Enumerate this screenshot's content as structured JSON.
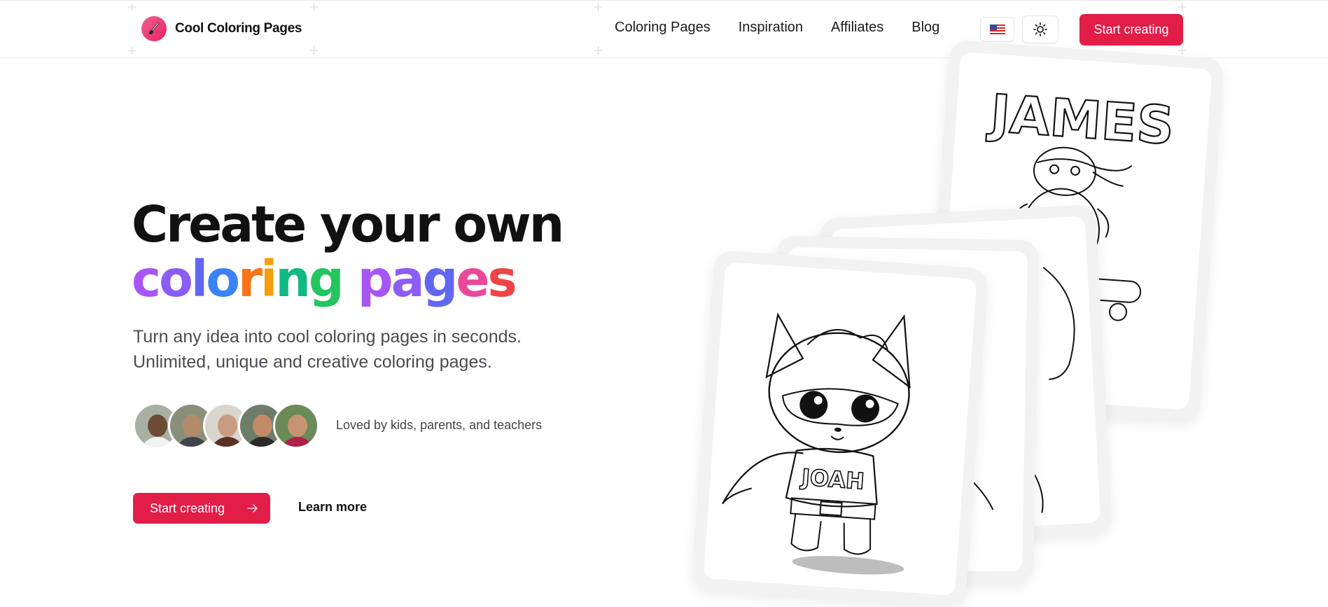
{
  "brand": {
    "name": "Cool Coloring Pages",
    "logo_icon": "paintbrush-icon",
    "accent": "#e11d48"
  },
  "nav": {
    "items": [
      {
        "label": "Coloring Pages"
      },
      {
        "label": "Inspiration"
      },
      {
        "label": "Affiliates"
      },
      {
        "label": "Blog"
      }
    ],
    "language_icon": "us-flag-icon",
    "theme_icon": "sun-icon",
    "cta_label": "Start creating"
  },
  "hero": {
    "title_line1": "Create your own",
    "title_word1_letters": [
      {
        "ch": "c",
        "color": "#a855f7"
      },
      {
        "ch": "o",
        "color": "#8b5cf6"
      },
      {
        "ch": "l",
        "color": "#6366f1"
      },
      {
        "ch": "o",
        "color": "#3b82f6"
      },
      {
        "ch": "r",
        "color": "#f97316"
      },
      {
        "ch": "i",
        "color": "#f59e0b"
      },
      {
        "ch": "n",
        "color": "#10b981"
      },
      {
        "ch": "g",
        "color": "#22c55e"
      }
    ],
    "title_word2_letters": [
      {
        "ch": "p",
        "color": "#a855f7"
      },
      {
        "ch": "a",
        "color": "#8b5cf6"
      },
      {
        "ch": "g",
        "color": "#6366f1"
      },
      {
        "ch": "e",
        "color": "#ec4899"
      },
      {
        "ch": "s",
        "color": "#ef4444"
      }
    ],
    "subtitle_line1": "Turn any idea into cool coloring pages in seconds.",
    "subtitle_line2": "Unlimited, unique and creative coloring pages.",
    "social_proof": "Loved by kids, parents, and teachers",
    "primary_cta": "Start creating",
    "primary_cta_icon": "arrow-right-icon",
    "secondary_cta": "Learn more"
  },
  "cards": {
    "back_card_name": "JAMES",
    "front_card_shirt": "JOAH"
  }
}
